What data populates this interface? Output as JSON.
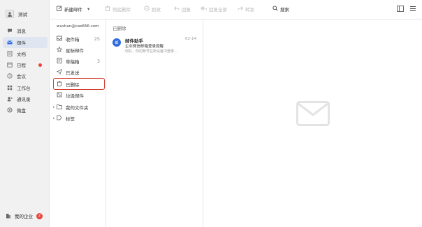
{
  "window": {
    "controls": [
      "#ff5f57",
      "#febc2e",
      "#28c840"
    ]
  },
  "left_nav": {
    "profile_name": "测试",
    "items": [
      {
        "label": "消息",
        "icon": "chat-icon"
      },
      {
        "label": "邮件",
        "icon": "mail-icon",
        "active": true
      },
      {
        "label": "文档",
        "icon": "doc-icon"
      },
      {
        "label": "日程",
        "icon": "calendar-icon",
        "has_dot": true
      },
      {
        "label": "会议",
        "icon": "meeting-icon"
      },
      {
        "label": "工作台",
        "icon": "grid-icon"
      },
      {
        "label": "通讯录",
        "icon": "contacts-icon"
      },
      {
        "label": "微盘",
        "icon": "drive-icon"
      }
    ],
    "enterprise_label": "我的企业",
    "enterprise_badge": "2"
  },
  "toolbar": {
    "new_mail": "新建邮件",
    "delete_permanent": "彻底删除",
    "recall": "拒收",
    "reply": "回复",
    "reply_all": "回复全部",
    "forward": "转发",
    "search": "搜索"
  },
  "folders": {
    "account": "wushan@cae666.com",
    "items": [
      {
        "label": "收件箱",
        "count": "25",
        "icon": "inbox-icon"
      },
      {
        "label": "星标邮件",
        "count": "",
        "icon": "star-icon"
      },
      {
        "label": "草稿箱",
        "count": "3",
        "icon": "draft-icon"
      },
      {
        "label": "已发送",
        "count": "",
        "icon": "sent-icon"
      },
      {
        "label": "已删除",
        "count": "",
        "icon": "trash-icon",
        "selected": true
      },
      {
        "label": "垃圾邮件",
        "count": "",
        "icon": "spam-icon"
      },
      {
        "label": "我的文件夹",
        "count": "",
        "icon": "folder-icon",
        "expandable": true
      },
      {
        "label": "标签",
        "count": "",
        "icon": "tag-icon",
        "expandable": true
      }
    ]
  },
  "mail_list": {
    "header": "已删除",
    "items": [
      {
        "avatar_text": "邮",
        "sender": "邮件助手",
        "date": "02-14",
        "subject": "企业微信邮箱登录提醒",
        "preview": "你好，你的账号在新设备中登录..."
      }
    ]
  },
  "colors": {
    "accent": "#2f6bdc",
    "selection_border": "#d0392b",
    "badge": "#e8443a"
  }
}
